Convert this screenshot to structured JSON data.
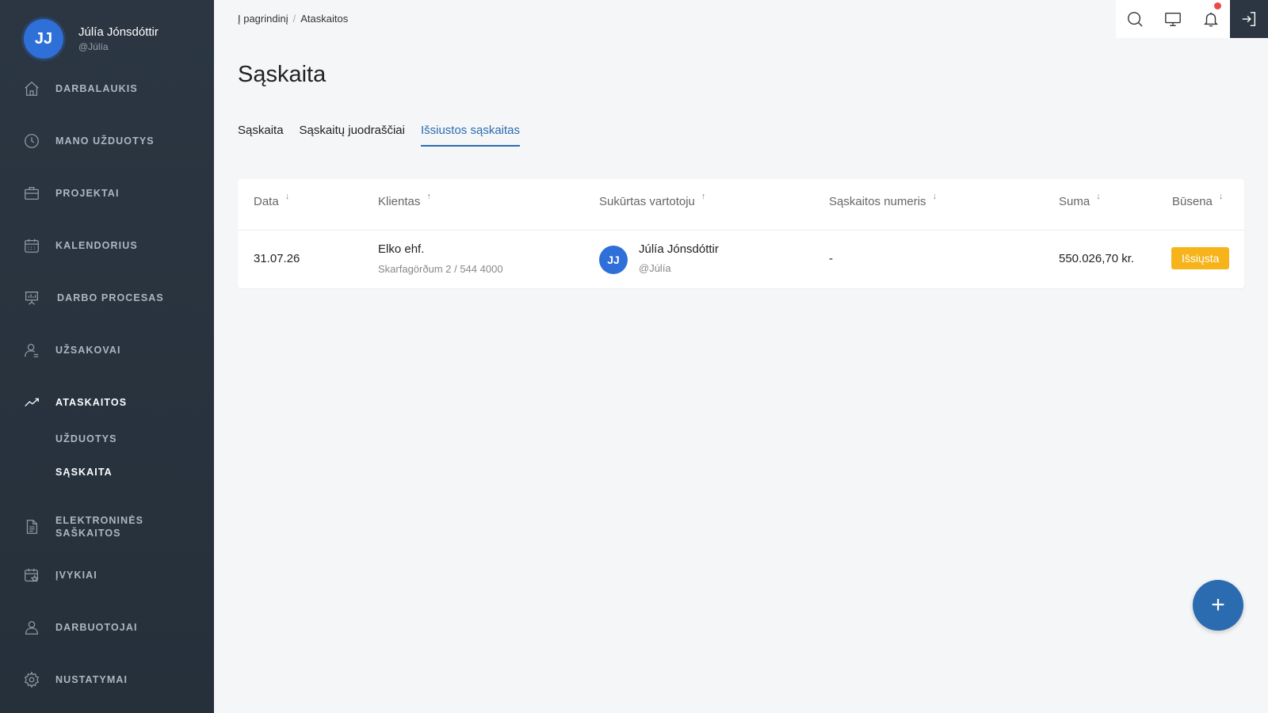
{
  "user": {
    "initials": "JJ",
    "name": "Júlía Jónsdóttir",
    "handle": "@Júlía"
  },
  "nav": {
    "items": [
      {
        "label": "DARBALAUKIS",
        "icon": "home-icon"
      },
      {
        "label": "MANO UŽDUOTYS",
        "icon": "clock-icon"
      },
      {
        "label": "PROJEKTAI",
        "icon": "briefcase-icon"
      },
      {
        "label": "KALENDORIUS",
        "icon": "calendar-icon"
      },
      {
        "label": "DARBO PROCESAS",
        "icon": "presentation-icon"
      },
      {
        "label": "UŽSAKOVAI",
        "icon": "user-icon"
      },
      {
        "label": "ATASKAITOS",
        "icon": "trend-icon"
      },
      {
        "label": "ELEKTRONINĖS SAŠKAITOS",
        "icon": "document-icon"
      },
      {
        "label": "ĮVYKIAI",
        "icon": "calendar-star-icon"
      },
      {
        "label": "DARBUOTOJAI",
        "icon": "users-icon"
      },
      {
        "label": "NUSTATYMAI",
        "icon": "gear-icon"
      }
    ],
    "sub_items": [
      {
        "label": "UŽDUOTYS"
      },
      {
        "label": "SĄSKAITA"
      }
    ]
  },
  "breadcrumb": {
    "home": "Į pagrindinį",
    "current": "Ataskaitos"
  },
  "page": {
    "title": "Sąskaita"
  },
  "tabs": [
    {
      "label": "Sąskaita"
    },
    {
      "label": "Sąskaitų juodraščiai"
    },
    {
      "label": "Išsiustos sąskaitas"
    }
  ],
  "table": {
    "columns": [
      {
        "label": "Data",
        "arrow": "↓"
      },
      {
        "label": "Klientas",
        "arrow": "↑"
      },
      {
        "label": "Sukūrtas vartotoju",
        "arrow": "↑"
      },
      {
        "label": "Sąskaitos numeris",
        "arrow": "↓"
      },
      {
        "label": "Suma",
        "arrow": "↓"
      },
      {
        "label": "Būsena",
        "arrow": "↓"
      }
    ],
    "rows": [
      {
        "date": "31.07.26",
        "client_name": "Elko ehf.",
        "client_address": "Skarfagörðum 2 / 544 4000",
        "creator_initials": "JJ",
        "creator_name": "Júlía Jónsdóttir",
        "creator_handle": "@Júlía",
        "invoice_number": "-",
        "amount": "550.026,70 kr.",
        "status": "Išsiųsta"
      }
    ]
  },
  "fab": {
    "label": "+"
  },
  "colors": {
    "accent": "#2b6cb0",
    "status": "#f6b31a",
    "sidebar": "#2b3642",
    "notification": "#e94b4b"
  }
}
